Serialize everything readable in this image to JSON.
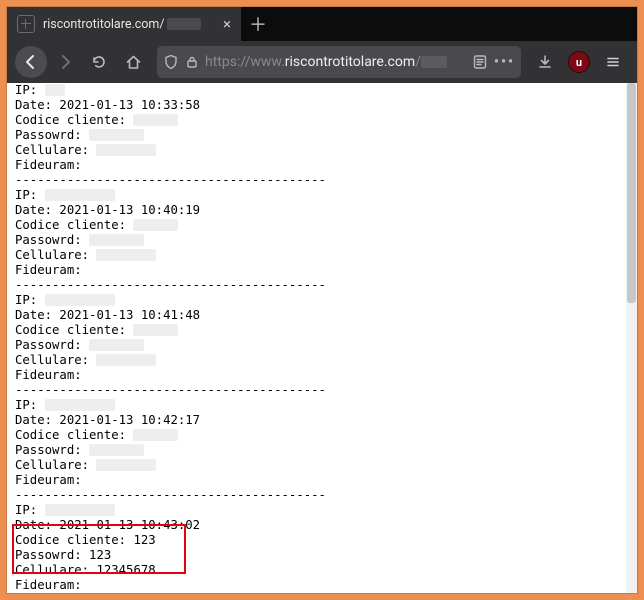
{
  "tab": {
    "title_visible": "riscontrotitolare.com/"
  },
  "toolbar": {
    "url_protocol": "https://www.",
    "url_host": "riscontrotitolare.com"
  },
  "separator": "------------------------------------------",
  "entries": [
    {
      "ip": "",
      "date": "2021-01-13 10:33:58",
      "codice_cliente": "",
      "passowrd": "",
      "cellulare": "",
      "fideuram": ""
    },
    {
      "ip": "",
      "date": "2021-01-13 10:40:19",
      "codice_cliente": "",
      "passowrd": "",
      "cellulare": "",
      "fideuram": ""
    },
    {
      "ip": "",
      "date": "2021-01-13 10:41:48",
      "codice_cliente": "",
      "passowrd": "",
      "cellulare": "",
      "fideuram": ""
    },
    {
      "ip": "",
      "date": "2021-01-13 10:42:17",
      "codice_cliente": "",
      "passowrd": "",
      "cellulare": "",
      "fideuram": ""
    },
    {
      "ip": "",
      "date": "2021-01-13 10:43:02",
      "codice_cliente": "123",
      "passowrd": "123",
      "cellulare": "12345678",
      "fideuram": ""
    }
  ],
  "labels": {
    "ip": "IP:",
    "date": "Date:",
    "codice": "Codice cliente:",
    "pass": "Passowrd:",
    "cell": "Cellulare:",
    "fid": "Fideuram:"
  },
  "highlight_entry_index": 4
}
